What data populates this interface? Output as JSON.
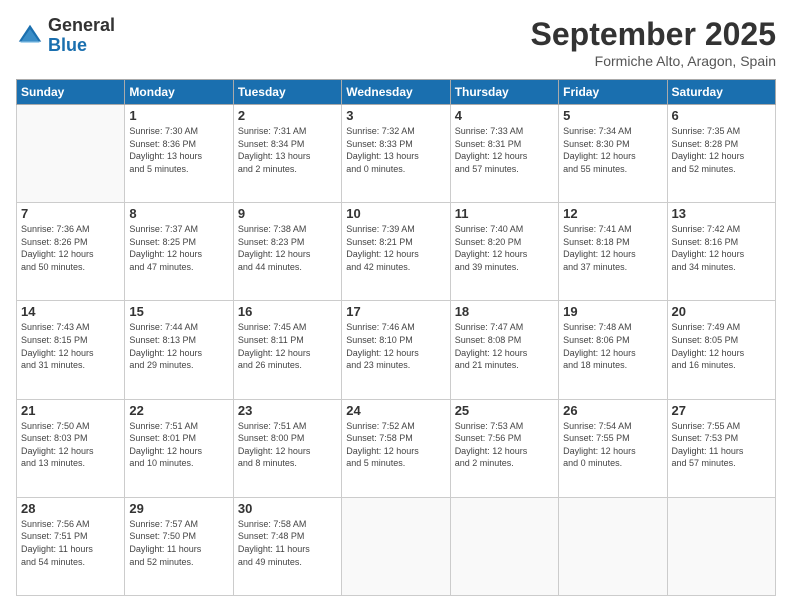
{
  "logo": {
    "general": "General",
    "blue": "Blue"
  },
  "title": "September 2025",
  "subtitle": "Formiche Alto, Aragon, Spain",
  "days_header": [
    "Sunday",
    "Monday",
    "Tuesday",
    "Wednesday",
    "Thursday",
    "Friday",
    "Saturday"
  ],
  "weeks": [
    [
      {
        "day": "",
        "info": ""
      },
      {
        "day": "1",
        "info": "Sunrise: 7:30 AM\nSunset: 8:36 PM\nDaylight: 13 hours\nand 5 minutes."
      },
      {
        "day": "2",
        "info": "Sunrise: 7:31 AM\nSunset: 8:34 PM\nDaylight: 13 hours\nand 2 minutes."
      },
      {
        "day": "3",
        "info": "Sunrise: 7:32 AM\nSunset: 8:33 PM\nDaylight: 13 hours\nand 0 minutes."
      },
      {
        "day": "4",
        "info": "Sunrise: 7:33 AM\nSunset: 8:31 PM\nDaylight: 12 hours\nand 57 minutes."
      },
      {
        "day": "5",
        "info": "Sunrise: 7:34 AM\nSunset: 8:30 PM\nDaylight: 12 hours\nand 55 minutes."
      },
      {
        "day": "6",
        "info": "Sunrise: 7:35 AM\nSunset: 8:28 PM\nDaylight: 12 hours\nand 52 minutes."
      }
    ],
    [
      {
        "day": "7",
        "info": "Sunrise: 7:36 AM\nSunset: 8:26 PM\nDaylight: 12 hours\nand 50 minutes."
      },
      {
        "day": "8",
        "info": "Sunrise: 7:37 AM\nSunset: 8:25 PM\nDaylight: 12 hours\nand 47 minutes."
      },
      {
        "day": "9",
        "info": "Sunrise: 7:38 AM\nSunset: 8:23 PM\nDaylight: 12 hours\nand 44 minutes."
      },
      {
        "day": "10",
        "info": "Sunrise: 7:39 AM\nSunset: 8:21 PM\nDaylight: 12 hours\nand 42 minutes."
      },
      {
        "day": "11",
        "info": "Sunrise: 7:40 AM\nSunset: 8:20 PM\nDaylight: 12 hours\nand 39 minutes."
      },
      {
        "day": "12",
        "info": "Sunrise: 7:41 AM\nSunset: 8:18 PM\nDaylight: 12 hours\nand 37 minutes."
      },
      {
        "day": "13",
        "info": "Sunrise: 7:42 AM\nSunset: 8:16 PM\nDaylight: 12 hours\nand 34 minutes."
      }
    ],
    [
      {
        "day": "14",
        "info": "Sunrise: 7:43 AM\nSunset: 8:15 PM\nDaylight: 12 hours\nand 31 minutes."
      },
      {
        "day": "15",
        "info": "Sunrise: 7:44 AM\nSunset: 8:13 PM\nDaylight: 12 hours\nand 29 minutes."
      },
      {
        "day": "16",
        "info": "Sunrise: 7:45 AM\nSunset: 8:11 PM\nDaylight: 12 hours\nand 26 minutes."
      },
      {
        "day": "17",
        "info": "Sunrise: 7:46 AM\nSunset: 8:10 PM\nDaylight: 12 hours\nand 23 minutes."
      },
      {
        "day": "18",
        "info": "Sunrise: 7:47 AM\nSunset: 8:08 PM\nDaylight: 12 hours\nand 21 minutes."
      },
      {
        "day": "19",
        "info": "Sunrise: 7:48 AM\nSunset: 8:06 PM\nDaylight: 12 hours\nand 18 minutes."
      },
      {
        "day": "20",
        "info": "Sunrise: 7:49 AM\nSunset: 8:05 PM\nDaylight: 12 hours\nand 16 minutes."
      }
    ],
    [
      {
        "day": "21",
        "info": "Sunrise: 7:50 AM\nSunset: 8:03 PM\nDaylight: 12 hours\nand 13 minutes."
      },
      {
        "day": "22",
        "info": "Sunrise: 7:51 AM\nSunset: 8:01 PM\nDaylight: 12 hours\nand 10 minutes."
      },
      {
        "day": "23",
        "info": "Sunrise: 7:51 AM\nSunset: 8:00 PM\nDaylight: 12 hours\nand 8 minutes."
      },
      {
        "day": "24",
        "info": "Sunrise: 7:52 AM\nSunset: 7:58 PM\nDaylight: 12 hours\nand 5 minutes."
      },
      {
        "day": "25",
        "info": "Sunrise: 7:53 AM\nSunset: 7:56 PM\nDaylight: 12 hours\nand 2 minutes."
      },
      {
        "day": "26",
        "info": "Sunrise: 7:54 AM\nSunset: 7:55 PM\nDaylight: 12 hours\nand 0 minutes."
      },
      {
        "day": "27",
        "info": "Sunrise: 7:55 AM\nSunset: 7:53 PM\nDaylight: 11 hours\nand 57 minutes."
      }
    ],
    [
      {
        "day": "28",
        "info": "Sunrise: 7:56 AM\nSunset: 7:51 PM\nDaylight: 11 hours\nand 54 minutes."
      },
      {
        "day": "29",
        "info": "Sunrise: 7:57 AM\nSunset: 7:50 PM\nDaylight: 11 hours\nand 52 minutes."
      },
      {
        "day": "30",
        "info": "Sunrise: 7:58 AM\nSunset: 7:48 PM\nDaylight: 11 hours\nand 49 minutes."
      },
      {
        "day": "",
        "info": ""
      },
      {
        "day": "",
        "info": ""
      },
      {
        "day": "",
        "info": ""
      },
      {
        "day": "",
        "info": ""
      }
    ]
  ]
}
